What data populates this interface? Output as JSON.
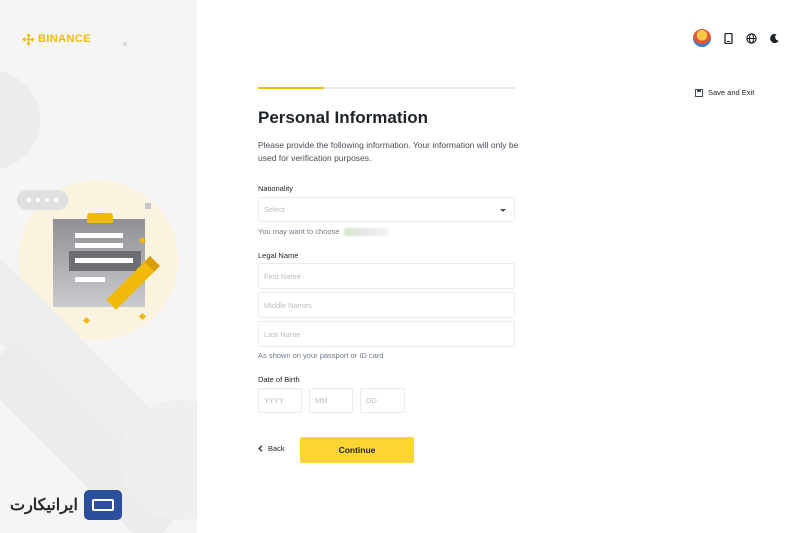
{
  "brand": {
    "name": "BINANCE",
    "color": "#f0b90b"
  },
  "header": {
    "save_exit_label": "Save and Exit",
    "icons": [
      "avatar",
      "mobile-icon",
      "globe-icon",
      "moon-icon"
    ]
  },
  "form": {
    "title": "Personal Information",
    "description": "Please provide the following information. Your information will only be used for verification purposes.",
    "nationality": {
      "label": "Nationality",
      "placeholder": "Select",
      "hint": "You may want to choose"
    },
    "legal_name": {
      "label": "Legal Name",
      "first_placeholder": "First Name",
      "middle_placeholder": "Middle Names",
      "last_placeholder": "Last Name",
      "hint": "As shown on your passport or ID card"
    },
    "dob": {
      "label": "Date of Birth",
      "year_placeholder": "YYYY",
      "month_placeholder": "MM",
      "day_placeholder": "DD"
    },
    "back_label": "Back",
    "continue_label": "Continue"
  },
  "watermark": {
    "text": "ایرانیکارت"
  },
  "colors": {
    "accent": "#fcd535",
    "text": "#1e2329",
    "muted": "#707a8a",
    "border": "#eaecef"
  }
}
